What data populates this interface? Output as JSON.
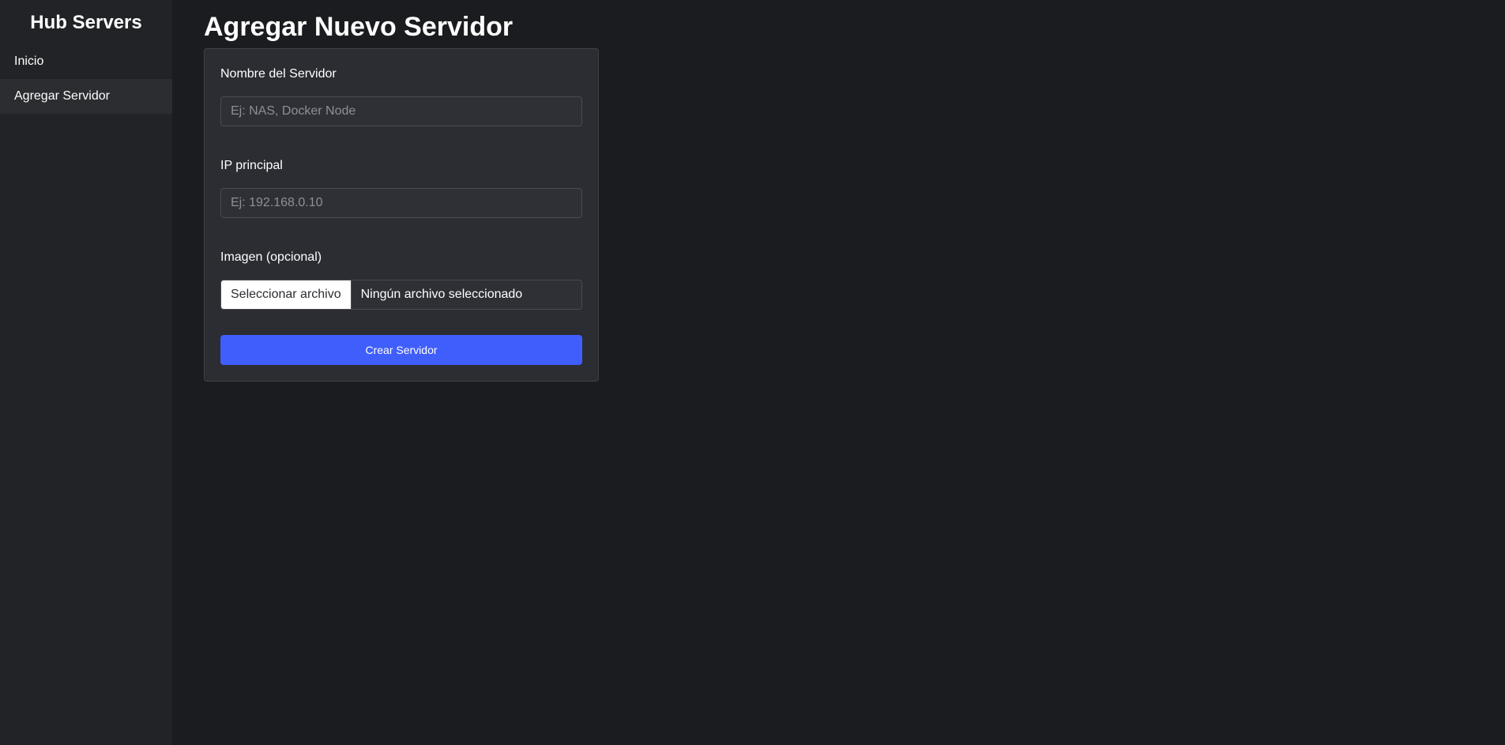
{
  "sidebar": {
    "brand": "Hub Servers",
    "items": [
      {
        "label": "Inicio",
        "active": false
      },
      {
        "label": "Agregar Servidor",
        "active": true
      }
    ]
  },
  "main": {
    "title": "Agregar Nuevo Servidor",
    "form": {
      "name_label": "Nombre del Servidor",
      "name_placeholder": "Ej: NAS, Docker Node",
      "name_value": "",
      "ip_label": "IP principal",
      "ip_placeholder": "Ej: 192.168.0.10",
      "ip_value": "",
      "image_label": "Imagen (opcional)",
      "file_button_label": "Seleccionar archivo",
      "file_status": "Ningún archivo seleccionado",
      "submit_label": "Crear Servidor"
    }
  },
  "colors": {
    "background": "#1b1c1f",
    "sidebar": "#222327",
    "card": "#2b2d32",
    "accent": "#3f5efb"
  }
}
